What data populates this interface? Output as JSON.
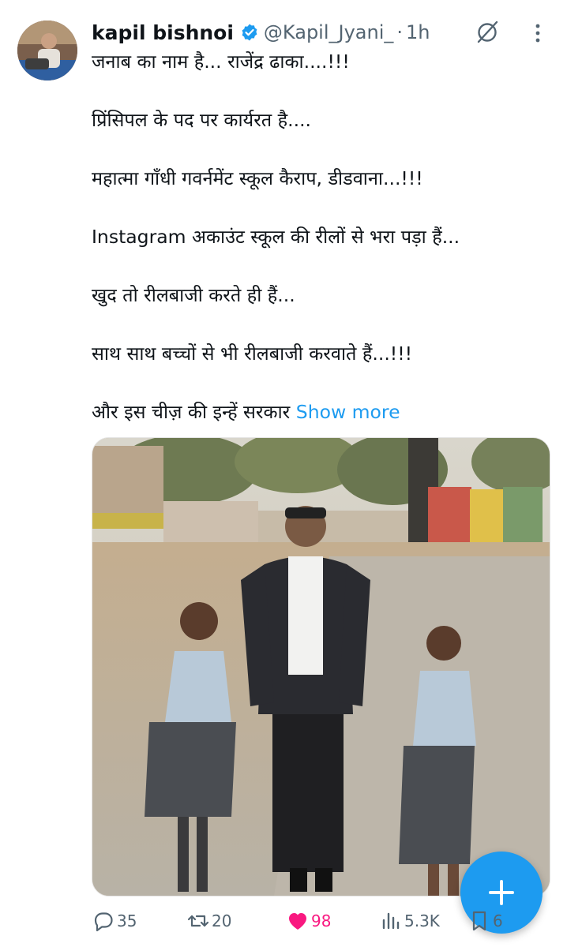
{
  "author": {
    "name": "kapil bishnoi",
    "handle": "@Kapil_Jyani_",
    "separator": "·",
    "time": "1h"
  },
  "tweet": {
    "lines": [
      "जनाब का नाम है... राजेंद्र ढाका....!!!",
      "प्रिंसिपल के पद पर कार्यरत है....",
      "महात्मा गाँधी गवर्नमेंट स्कूल कैराप, डीडवाना...!!!",
      "Instagram अकाउंट स्कूल की रीलों से भरा पड़ा हैं...",
      "खुद तो रीलबाजी करते ही हैं...",
      "साथ साथ बच्चों से भी रीलबाजी करवाते हैं...!!!"
    ],
    "last_line": "और इस चीज़ की इन्हें सरकार",
    "show_more": "Show more"
  },
  "actions": {
    "replies": "35",
    "reposts": "20",
    "likes": "98",
    "views": "5.3K",
    "bookmarks": "6"
  },
  "colors": {
    "accent": "#1d9bf0",
    "like": "#f91880",
    "muted": "#536471"
  },
  "icons": [
    "grok-icon",
    "more-icon",
    "verified-badge-icon",
    "reply-icon",
    "repost-icon",
    "heart-icon",
    "views-icon",
    "bookmark-icon",
    "plus-icon"
  ]
}
